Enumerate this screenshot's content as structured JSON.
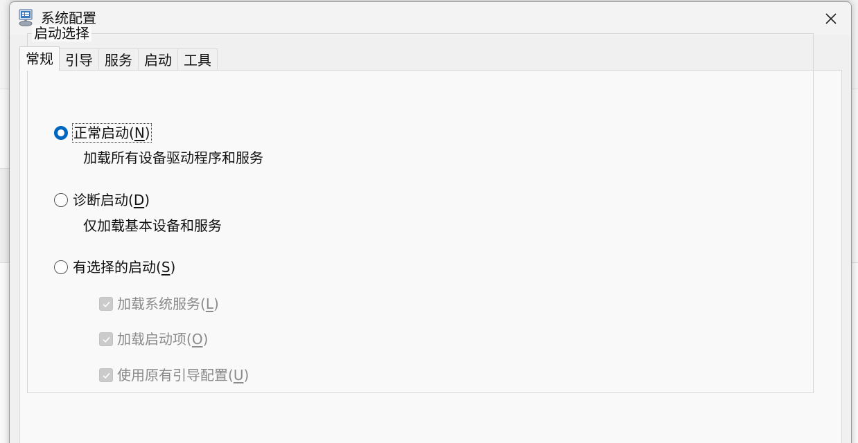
{
  "window": {
    "title": "系统配置",
    "icon": "msconfig-icon"
  },
  "tabs": [
    {
      "label": "常规",
      "active": true
    },
    {
      "label": "引导",
      "active": false
    },
    {
      "label": "服务",
      "active": false
    },
    {
      "label": "启动",
      "active": false
    },
    {
      "label": "工具",
      "active": false
    }
  ],
  "startup_selection": {
    "group_label": "启动选择",
    "normal": {
      "label": "正常启动(",
      "accel": "N",
      "suffix": ")",
      "description": "加载所有设备驱动程序和服务",
      "checked": true
    },
    "diagnostic": {
      "label": "诊断启动(",
      "accel": "D",
      "suffix": ")",
      "description": "仅加载基本设备和服务",
      "checked": false
    },
    "selective": {
      "label": "有选择的启动(",
      "accel": "S",
      "suffix": ")",
      "checked": false,
      "options": [
        {
          "label": "加载系统服务(",
          "accel": "L",
          "suffix": ")",
          "checked": true,
          "enabled": false
        },
        {
          "label": "加载启动项(",
          "accel": "O",
          "suffix": ")",
          "checked": true,
          "enabled": false
        },
        {
          "label": "使用原有引导配置(",
          "accel": "U",
          "suffix": ")",
          "checked": true,
          "enabled": false
        }
      ]
    }
  },
  "colors": {
    "accent": "#0067c0",
    "disabled_text": "#8a8a8a"
  }
}
